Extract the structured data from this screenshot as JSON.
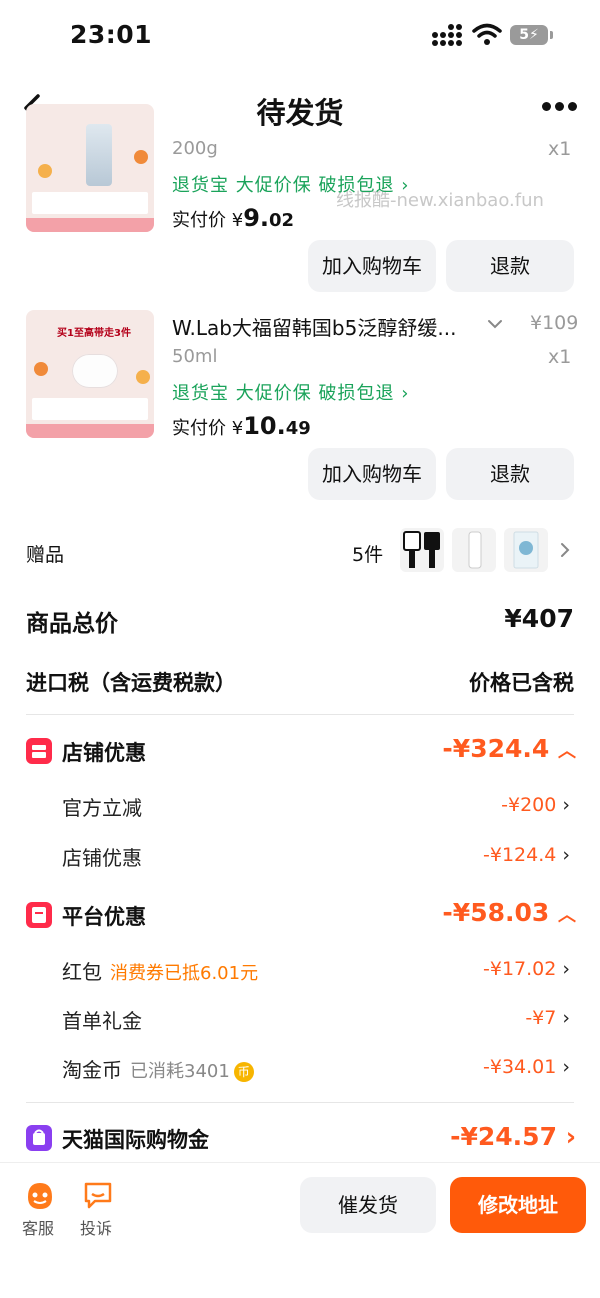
{
  "status_bar": {
    "time": "23:01",
    "battery": "5"
  },
  "nav": {
    "title": "待发货"
  },
  "watermark": "线报酷-new.xianbao.fun",
  "products": [
    {
      "spec": "200g",
      "qty": "x1",
      "tags": "退货宝  大促价保  破损包退",
      "paid_label": "实付价",
      "paid_currency": "¥",
      "paid_int": "9.",
      "paid_dec": "02",
      "add_cart": "加入购物车",
      "refund": "退款"
    },
    {
      "title": "W.Lab大福留韩国b5泛醇舒缓...",
      "price": "¥109",
      "spec": "50ml",
      "qty": "x1",
      "tags": "退货宝  大促价保  破损包退",
      "paid_label": "实付价",
      "paid_currency": "¥",
      "paid_int": "10.",
      "paid_dec": "49",
      "thumb_banner": "买1至高带走3件",
      "add_cart": "加入购物车",
      "refund": "退款"
    }
  ],
  "gifts": {
    "label": "赠品",
    "count": "5件"
  },
  "totals": {
    "goods_total_label": "商品总价",
    "goods_total_value": "¥407",
    "tax_label": "进口税（含运费税款）",
    "tax_value": "价格已含税"
  },
  "store_discount": {
    "title": "店铺优惠",
    "value": "-¥324.4",
    "items": [
      {
        "label": "官方立减",
        "value": "-¥200"
      },
      {
        "label": "店铺优惠",
        "value": "-¥124.4"
      }
    ]
  },
  "platform_discount": {
    "title": "平台优惠",
    "value": "-¥58.03",
    "items": [
      {
        "label": "红包",
        "note": "消费券已抵6.01元",
        "value": "-¥17.02"
      },
      {
        "label": "首单礼金",
        "value": "-¥7"
      },
      {
        "label": "淘金币",
        "note": "已消耗3401",
        "coin": "币",
        "value": "-¥34.01"
      }
    ]
  },
  "tmall_gold": {
    "title": "天猫国际购物金",
    "value": "-¥24.57"
  },
  "bottom": {
    "service": "客服",
    "complaint": "投诉",
    "urge": "催发货",
    "modify": "修改地址"
  },
  "colors": {
    "accent": "#ff5a1f",
    "tag_green": "#1aa35a",
    "primary_button": "#ff5a0a"
  }
}
